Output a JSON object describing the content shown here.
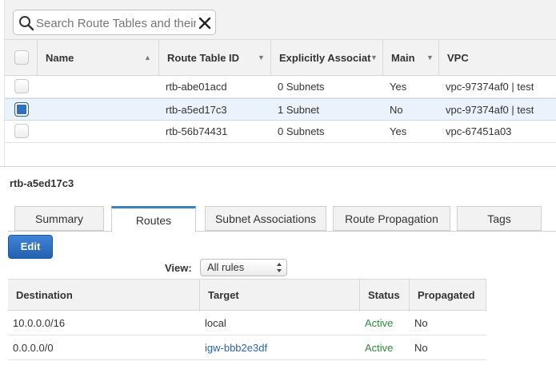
{
  "search": {
    "placeholder": "Search Route Tables and their properties"
  },
  "table": {
    "columns": [
      "Name",
      "Route Table ID",
      "Explicitly Associat",
      "Main",
      "VPC"
    ],
    "rows": [
      {
        "name": "",
        "id": "rtb-abe01acd",
        "assoc": "0 Subnets",
        "main": "Yes",
        "vpc": "vpc-97374af0 | test",
        "selected": false
      },
      {
        "name": "",
        "id": "rtb-a5ed17c3",
        "assoc": "1 Subnet",
        "main": "No",
        "vpc": "vpc-97374af0 | test",
        "selected": true
      },
      {
        "name": "",
        "id": "rtb-56b74431",
        "assoc": "0 Subnets",
        "main": "Yes",
        "vpc": "vpc-67451a03",
        "selected": false
      }
    ]
  },
  "detail": {
    "title": "rtb-a5ed17c3",
    "tabs": [
      "Summary",
      "Routes",
      "Subnet Associations",
      "Route Propagation",
      "Tags"
    ],
    "active_tab": "Routes",
    "edit_label": "Edit",
    "view_label": "View:",
    "view_selected": "All rules"
  },
  "routes": {
    "columns": [
      "Destination",
      "Target",
      "Status",
      "Propagated"
    ],
    "rows": [
      {
        "destination": "10.0.0.0/16",
        "target": "local",
        "status": "Active",
        "propagated": "No"
      },
      {
        "destination": "0.0.0.0/0",
        "target": "igw-bbb2e3df",
        "status": "Active",
        "propagated": "No"
      }
    ]
  },
  "colors": {
    "accent": "#3b83c4",
    "button": "#2f6fc0",
    "status_active": "#2e8b3a",
    "link": "#2a64b0",
    "selected_row": "#eaf2fb"
  }
}
